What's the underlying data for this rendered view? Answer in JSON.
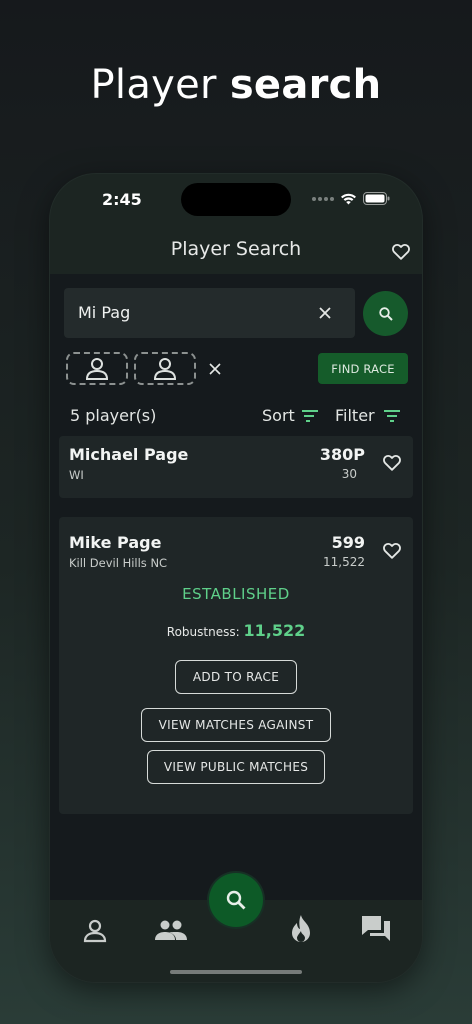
{
  "promo": {
    "title_normal": "Player",
    "title_bold": "search"
  },
  "status_bar": {
    "time": "2:45"
  },
  "app_bar": {
    "title": "Player Search"
  },
  "search": {
    "value": "Mi Pag",
    "placeholder": ""
  },
  "race": {
    "find_label": "FIND RACE"
  },
  "results": {
    "count_label": "5 player(s)",
    "sort_label": "Sort",
    "filter_label": "Filter"
  },
  "players": [
    {
      "name": "Michael Page",
      "location": "WI",
      "score": "380P",
      "sub": "30"
    },
    {
      "name": "Mike Page",
      "location": "Kill Devil Hills NC",
      "score": "599",
      "sub": "11,522",
      "status": "ESTABLISHED",
      "robustness_label": "Robustness:",
      "robustness_value": "11,522",
      "add_label": "ADD TO RACE",
      "against_label": "VIEW MATCHES AGAINST",
      "public_label": "VIEW PUBLIC MATCHES"
    }
  ],
  "colors": {
    "accent": "#165a2c",
    "accent_text": "#5fd08a",
    "card": "#1f2627",
    "background": "#151a1d"
  },
  "icons": [
    "heart-icon",
    "clear-icon",
    "search-icon",
    "person-icon",
    "sort-icon",
    "filter-icon",
    "people-icon",
    "flame-icon",
    "chat-icon"
  ]
}
